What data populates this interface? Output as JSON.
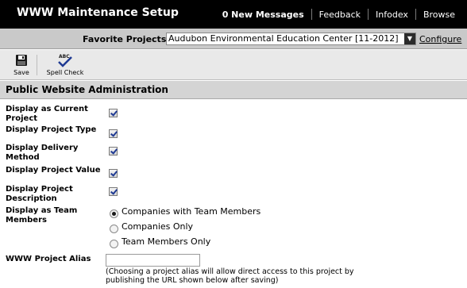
{
  "header": {
    "title": "WWW Maintenance Setup",
    "nav": [
      {
        "label": "0 New Messages"
      },
      {
        "label": "Feedback"
      },
      {
        "label": "Infodex"
      },
      {
        "label": "Browse"
      }
    ]
  },
  "favorites": {
    "label": "Favorite Projects",
    "selected": "Audubon Environmental Education Center [11-2012]",
    "configure_label": "Configure"
  },
  "toolbar": {
    "save_label": "Save",
    "spell_label": "Spell Check",
    "spell_icon_text": "ABC"
  },
  "section": {
    "title": "Public Website Administration"
  },
  "form": {
    "fields": [
      {
        "label": "Display as Current Project",
        "checked": true
      },
      {
        "label": "Display Project Type",
        "checked": true
      },
      {
        "label": "Display Delivery Method",
        "checked": true
      },
      {
        "label": "Display Project Value",
        "checked": true
      },
      {
        "label": "Display Project Description",
        "checked": true
      }
    ],
    "team_label": "Display as Team Members",
    "team_options": [
      {
        "label": "Companies with Team Members",
        "selected": true
      },
      {
        "label": "Companies Only",
        "selected": false
      },
      {
        "label": "Team Members Only",
        "selected": false
      }
    ],
    "alias_label": "WWW Project Alias",
    "alias_value": "",
    "alias_help": "(Choosing a project alias will allow direct access to this project by publishing the URL shown below after saving)"
  },
  "colors": {
    "topbar": "#000000",
    "favbar": "#c9c9c9",
    "toolbar": "#e9e9e9",
    "section_header": "#d4d4d4",
    "check": "#1f3a93"
  }
}
